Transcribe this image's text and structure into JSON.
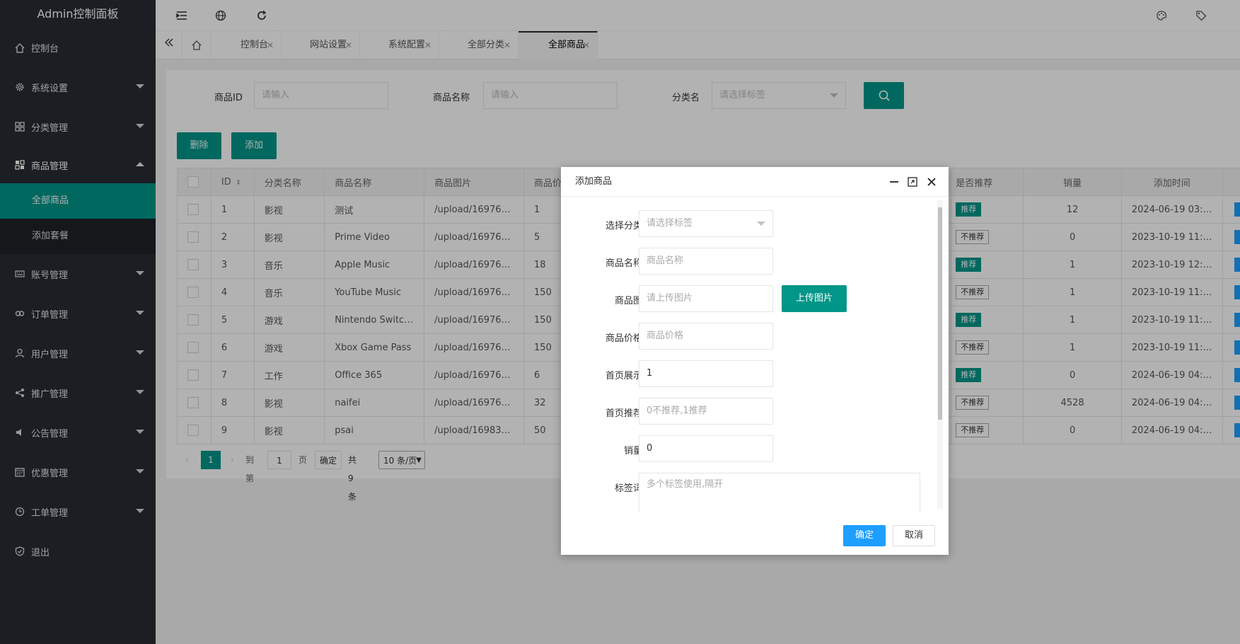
{
  "app": {
    "title": "Admin控制面板"
  },
  "sidebar": {
    "items": [
      {
        "label": "控制台",
        "icon": "home-icon"
      },
      {
        "label": "系统设置",
        "icon": "gear-icon"
      },
      {
        "label": "分类管理",
        "icon": "grid-icon"
      },
      {
        "label": "商品管理",
        "icon": "grid-icon",
        "open": true
      },
      {
        "label": "账号管理",
        "icon": "keyboard-icon"
      },
      {
        "label": "订单管理",
        "icon": "link-icon"
      },
      {
        "label": "用户管理",
        "icon": "user-icon"
      },
      {
        "label": "推广管理",
        "icon": "share-icon"
      },
      {
        "label": "公告管理",
        "icon": "speaker-icon"
      },
      {
        "label": "优惠管理",
        "icon": "calendar-icon"
      },
      {
        "label": "工单管理",
        "icon": "clock-icon"
      },
      {
        "label": "退出",
        "icon": "shield-icon"
      }
    ],
    "sub_items": [
      {
        "label": "全部商品",
        "active": true
      },
      {
        "label": "添加套餐",
        "active": false
      }
    ]
  },
  "tabs": [
    {
      "label": "控制台"
    },
    {
      "label": "网站设置"
    },
    {
      "label": "系统配置"
    },
    {
      "label": "全部分类"
    },
    {
      "label": "全部商品",
      "active": true
    }
  ],
  "search": {
    "id_label": "商品ID",
    "id_placeholder": "请输入",
    "name_label": "商品名称",
    "name_placeholder": "请输入",
    "cat_label": "分类名",
    "cat_placeholder": "请选择标签"
  },
  "toolbar": {
    "delete_label": "删除",
    "add_label": "添加"
  },
  "table": {
    "headers": [
      "ID",
      "分类名称",
      "商品名称",
      "商品图片",
      "商品价",
      "是否推荐",
      "销量",
      "添加时间"
    ],
    "rows": [
      {
        "id": "1",
        "cat": "影视",
        "name": "测试",
        "img": "/upload/16976…",
        "price": "1",
        "rec": "推荐",
        "recommended": true,
        "sales": "12",
        "time": "2024-06-19 03:…"
      },
      {
        "id": "2",
        "cat": "影视",
        "name": "Prime Video",
        "img": "/upload/16976…",
        "price": "5",
        "rec": "不推荐",
        "recommended": false,
        "sales": "0",
        "time": "2023-10-19 11:…"
      },
      {
        "id": "3",
        "cat": "音乐",
        "name": "Apple Music",
        "img": "/upload/16976…",
        "price": "18",
        "rec": "推荐",
        "recommended": true,
        "sales": "1",
        "time": "2023-10-19 12:…"
      },
      {
        "id": "4",
        "cat": "音乐",
        "name": "YouTube Music",
        "img": "/upload/16976…",
        "price": "150",
        "rec": "不推荐",
        "recommended": false,
        "sales": "1",
        "time": "2023-10-19 11:…"
      },
      {
        "id": "5",
        "cat": "游戏",
        "name": "Nintendo Switc…",
        "img": "/upload/16976…",
        "price": "150",
        "rec": "推荐",
        "recommended": true,
        "sales": "1",
        "time": "2023-10-19 11:…"
      },
      {
        "id": "6",
        "cat": "游戏",
        "name": "Xbox Game Pass",
        "img": "/upload/16976…",
        "price": "150",
        "rec": "不推荐",
        "recommended": false,
        "sales": "1",
        "time": "2023-10-19 11:…"
      },
      {
        "id": "7",
        "cat": "工作",
        "name": "Office 365",
        "img": "/upload/16976…",
        "price": "6",
        "rec": "推荐",
        "recommended": true,
        "sales": "0",
        "time": "2024-06-19 04:…"
      },
      {
        "id": "8",
        "cat": "影视",
        "name": "naifei",
        "img": "/upload/16976…",
        "price": "32",
        "rec": "不推荐",
        "recommended": false,
        "sales": "4528",
        "time": "2024-06-19 04:…"
      },
      {
        "id": "9",
        "cat": "影视",
        "name": "psai",
        "img": "/upload/16983…",
        "price": "50",
        "rec": "不推荐",
        "recommended": false,
        "sales": "0",
        "time": "2024-06-19 04:…"
      }
    ]
  },
  "pager": {
    "current": "1",
    "goto_label": "到第",
    "goto_value": "1",
    "page_unit": "页",
    "confirm": "确定",
    "total": "共 9 条",
    "per_page": "10 条/页"
  },
  "dialog": {
    "title": "添加商品",
    "fields": [
      {
        "label": "选择分类",
        "placeholder": "请选择标签"
      },
      {
        "label": "商品名称",
        "placeholder": "商品名称"
      },
      {
        "label": "商品图",
        "placeholder": "请上传图片"
      },
      {
        "label": "商品价格",
        "placeholder": "商品价格"
      },
      {
        "label": "首页展示",
        "value": "1"
      },
      {
        "label": "首页推荐",
        "placeholder": "0不推荐,1推荐"
      },
      {
        "label": "销量",
        "value": "0"
      },
      {
        "label": "标签词",
        "placeholder": "多个标签使用,隔开"
      }
    ],
    "upload_label": "上传图片",
    "ok_label": "确定",
    "cancel_label": "取消"
  },
  "colors": {
    "accent": "#009688",
    "sidebar": "#282b33",
    "primary_blue": "#1e9fff"
  }
}
